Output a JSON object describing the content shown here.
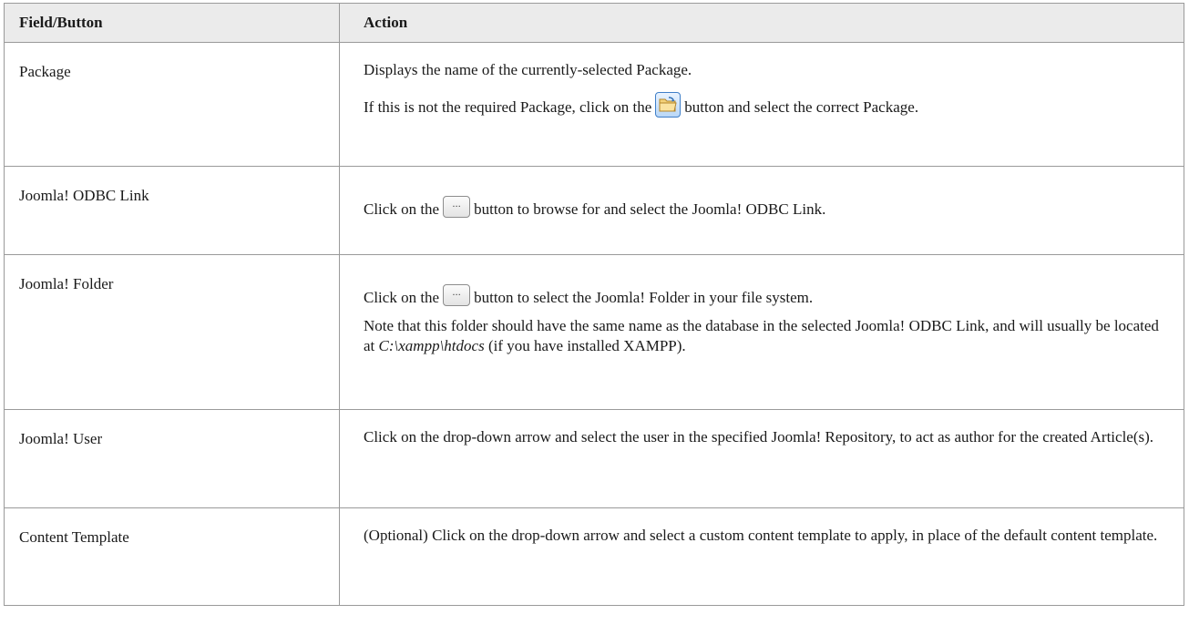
{
  "table": {
    "headers": {
      "field": "Field/Button",
      "action": "Action"
    },
    "rows": [
      {
        "field": "Package",
        "p1": "Displays the name of the currently-selected Package.",
        "p2_before": "If this is not the required Package, click on the",
        "p2_after": "button and select the correct Package.",
        "button_icon": "folder-open-icon"
      },
      {
        "field": "Joomla! ODBC Link",
        "p1_before": "Click on the",
        "p1_after": "button to browse for and select the Joomla! ODBC Link.",
        "button_label": "..."
      },
      {
        "field": "Joomla! Folder",
        "p1_before": "Click on the",
        "p1_after": "button to select the Joomla! Folder in your file system.",
        "button_label": "...",
        "p2_before": "Note that this folder should have the same name as the database in the selected Joomla! ODBC Link, and will usually be located at",
        "p2_path": "C:\\xampp\\htdocs",
        "p2_after": "(if you have installed XAMPP)."
      },
      {
        "field": "Joomla! User",
        "p1": "Click on the drop-down arrow and select the user in the specified Joomla! Repository, to act as author for the created Article(s)."
      },
      {
        "field": "Content Template",
        "p1": "(Optional) Click on the drop-down arrow and select a custom content template to apply, in place of the default content template."
      }
    ]
  },
  "colors": {
    "header_bg": "#ebebeb",
    "border": "#9a9a9a"
  }
}
